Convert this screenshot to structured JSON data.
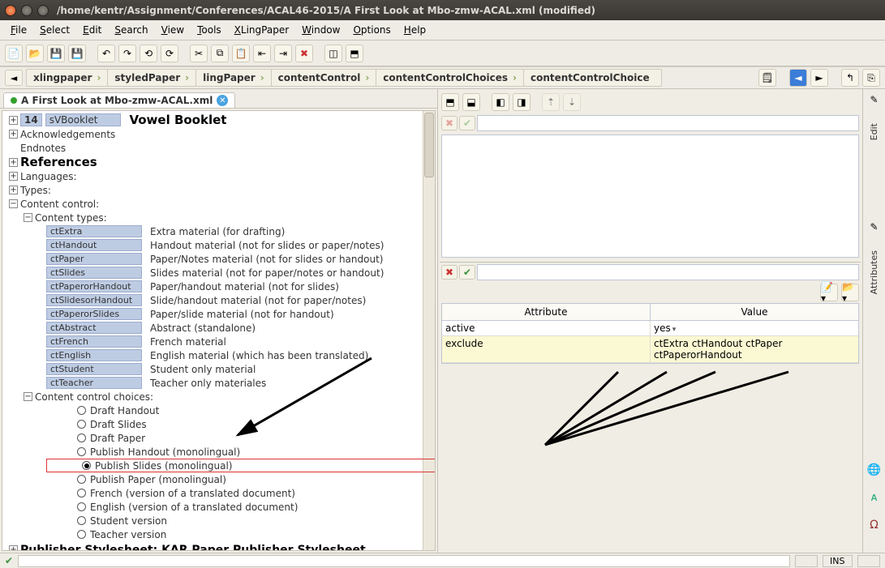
{
  "titlebar": "/home/kentr/Assignment/Conferences/ACAL46-2015/A First Look at Mbo-zmw-ACAL.xml (modified)",
  "menu": [
    "File",
    "Select",
    "Edit",
    "Search",
    "View",
    "Tools",
    "XLingPaper",
    "Window",
    "Options",
    "Help"
  ],
  "breadcrumb": [
    "xlingpaper",
    "styledPaper",
    "lingPaper",
    "contentControl",
    "contentControlChoices",
    "contentControlChoice"
  ],
  "tab": {
    "label": "A First Look at Mbo-zmw-ACAL.xml"
  },
  "doc": {
    "num": "14",
    "code": "sVBooklet",
    "vowel": "Vowel Booklet",
    "ack": "Acknowledgements",
    "end": "Endnotes",
    "refs": "References",
    "langs": "Languages:",
    "types": "Types:",
    "cc": "Content control:",
    "ctypes": "Content types:",
    "ctrows": [
      {
        "tag": "ctExtra",
        "desc": "Extra material (for drafting)"
      },
      {
        "tag": "ctHandout",
        "desc": "Handout material (not for slides or paper/notes)"
      },
      {
        "tag": "ctPaper",
        "desc": "Paper/Notes material (not for slides or handout)"
      },
      {
        "tag": "ctSlides",
        "desc": "Slides material (not for paper/notes or handout)"
      },
      {
        "tag": "ctPaperorHandout",
        "desc": "Paper/handout material (not for slides)"
      },
      {
        "tag": "ctSlidesorHandout",
        "desc": "Slide/handout material (not for paper/notes)"
      },
      {
        "tag": "ctPaperorSlides",
        "desc": "Paper/slide material (not for handout)"
      },
      {
        "tag": "ctAbstract",
        "desc": "Abstract (standalone)"
      },
      {
        "tag": "ctFrench",
        "desc": "French material"
      },
      {
        "tag": "ctEnglish",
        "desc": "English material (which has been translated)"
      },
      {
        "tag": "ctStudent",
        "desc": "Student only material"
      },
      {
        "tag": "ctTeacher",
        "desc": "Teacher only materiales"
      }
    ],
    "ccc": "Content control choices:",
    "choices": [
      "Draft Handout",
      "Draft Slides",
      "Draft Paper",
      "Publish Handout (monolingual)",
      "Publish Slides (monolingual)",
      "Publish Paper (monolingual)",
      "French (version of a translated document)",
      "English (version of a translated document)",
      "Student version",
      "Teacher version"
    ],
    "selected_choice_index": 4,
    "pub": "Publisher Stylesheet: KAR Paper Publisher Stylesheet"
  },
  "attr": {
    "head": {
      "a": "Attribute",
      "v": "Value"
    },
    "rows": [
      {
        "a": "active",
        "v": "yes"
      },
      {
        "a": "exclude",
        "v": "ctExtra ctHandout ctPaper ctPaperorHandout"
      }
    ]
  },
  "sidebar": {
    "edit": "Edit",
    "attrs": "Attributes"
  },
  "status": {
    "ins": "INS"
  }
}
